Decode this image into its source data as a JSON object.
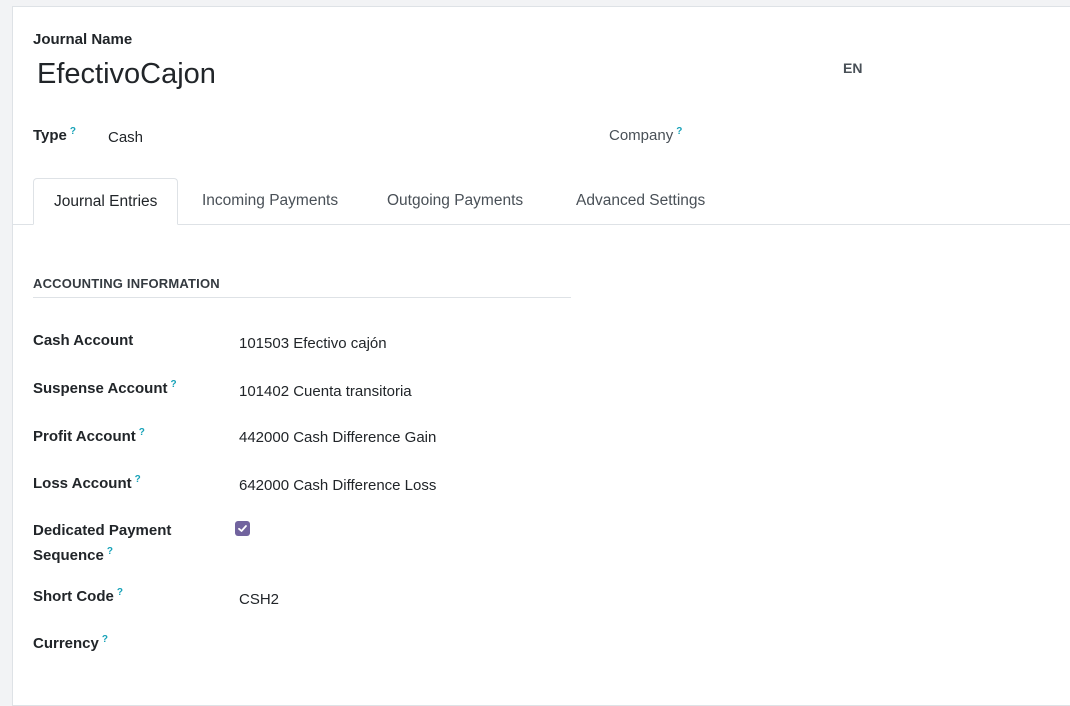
{
  "header": {
    "name_label": "Journal Name",
    "name_value": "EfectivoCajon",
    "lang_button": "EN",
    "type_label": "Type",
    "type_value": "Cash",
    "company_label": "Company",
    "help_mark": "?"
  },
  "tabs": [
    {
      "label": "Journal Entries",
      "active": true
    },
    {
      "label": "Incoming Payments",
      "active": false
    },
    {
      "label": "Outgoing Payments",
      "active": false
    },
    {
      "label": "Advanced Settings",
      "active": false
    }
  ],
  "section": {
    "title": "ACCOUNTING INFORMATION"
  },
  "fields": {
    "cash_account": {
      "label": "Cash Account",
      "value": "101503 Efectivo cajón"
    },
    "suspense_account": {
      "label": "Suspense Account",
      "value": "101402 Cuenta transitoria"
    },
    "profit_account": {
      "label": "Profit Account",
      "value": "442000 Cash Difference Gain"
    },
    "loss_account": {
      "label": "Loss Account",
      "value": "642000 Cash Difference Loss"
    },
    "dedicated_sequence": {
      "label_line1": "Dedicated Payment",
      "label_line2": "Sequence",
      "checked": true
    },
    "short_code": {
      "label": "Short Code",
      "value": "CSH2"
    },
    "currency": {
      "label": "Currency",
      "value": ""
    }
  },
  "colors": {
    "accent": "#71639e",
    "help": "#17a2b8"
  },
  "icons": {
    "checkbox": "check-icon"
  }
}
